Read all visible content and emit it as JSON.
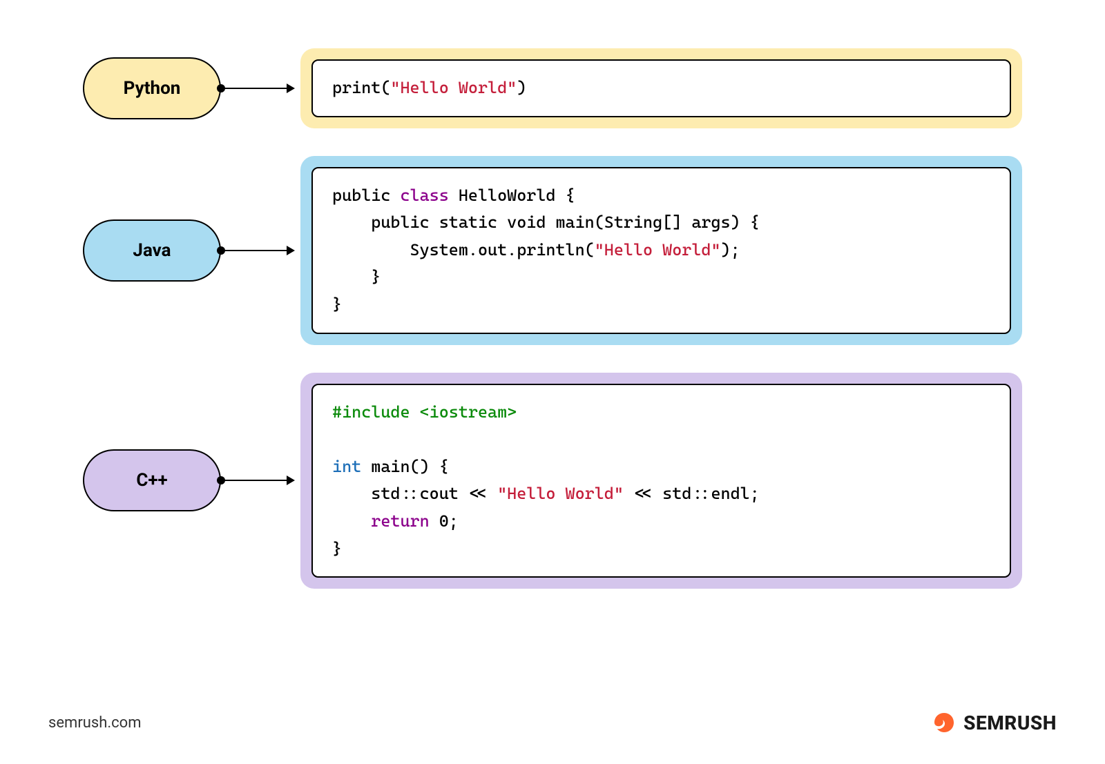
{
  "languages": [
    {
      "name": "Python",
      "pill_color": "yellow",
      "code_tokens": [
        {
          "t": "print(",
          "c": ""
        },
        {
          "t": "\"Hello World\"",
          "c": "tok-str"
        },
        {
          "t": ")",
          "c": ""
        }
      ]
    },
    {
      "name": "Java",
      "pill_color": "blue",
      "code_tokens": [
        {
          "t": "public ",
          "c": ""
        },
        {
          "t": "class",
          "c": "tok-kw"
        },
        {
          "t": " HelloWorld {\n    public static void main(String[] args) {\n        System.out.println(",
          "c": ""
        },
        {
          "t": "\"Hello World\"",
          "c": "tok-str"
        },
        {
          "t": ");\n    }\n}",
          "c": ""
        }
      ]
    },
    {
      "name": "C++",
      "pill_color": "purple",
      "code_tokens": [
        {
          "t": "#include <iostream>",
          "c": "tok-pre"
        },
        {
          "t": "\n\n",
          "c": ""
        },
        {
          "t": "int",
          "c": "tok-type"
        },
        {
          "t": " main() {\n    std::cout << ",
          "c": ""
        },
        {
          "t": "\"Hello World\"",
          "c": "tok-str"
        },
        {
          "t": " << std::endl;\n    ",
          "c": ""
        },
        {
          "t": "return",
          "c": "tok-kw"
        },
        {
          "t": " 0;\n}",
          "c": ""
        }
      ]
    }
  ],
  "footer": {
    "url": "semrush.com",
    "brand": "SEMRUSH"
  }
}
